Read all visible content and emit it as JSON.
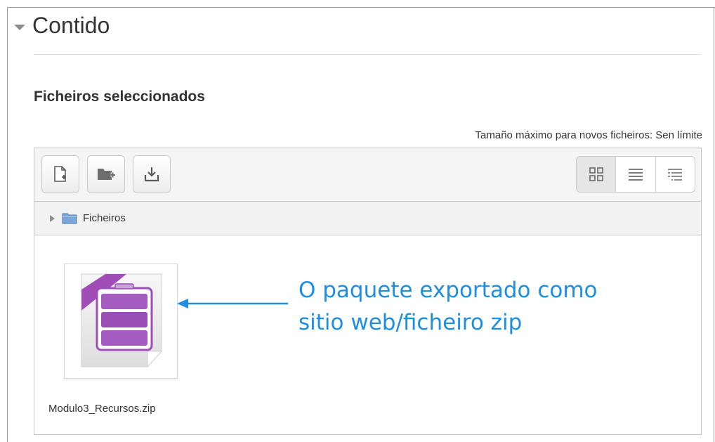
{
  "section": {
    "title": "Contido"
  },
  "field": {
    "label": "Ficheiros seleccionados",
    "max_size_text": "Tamaño máximo para novos ficheiros: Sen límite"
  },
  "toolbar": {
    "buttons": [
      {
        "icon": "add-file-icon"
      },
      {
        "icon": "create-folder-icon"
      },
      {
        "icon": "download-icon"
      }
    ],
    "view_buttons": [
      {
        "icon": "grid-view-icon",
        "active": true
      },
      {
        "icon": "list-view-icon",
        "active": false
      },
      {
        "icon": "tree-view-icon",
        "active": false
      }
    ]
  },
  "path": {
    "label": "Ficheiros"
  },
  "file": {
    "name": "Modulo3_Recursos.zip",
    "icon": "zip-archive-icon"
  },
  "annotation": {
    "line1": "O paquete exportado como",
    "line2": "sitio web/ficheiro zip",
    "color": "#1e8fe0"
  }
}
